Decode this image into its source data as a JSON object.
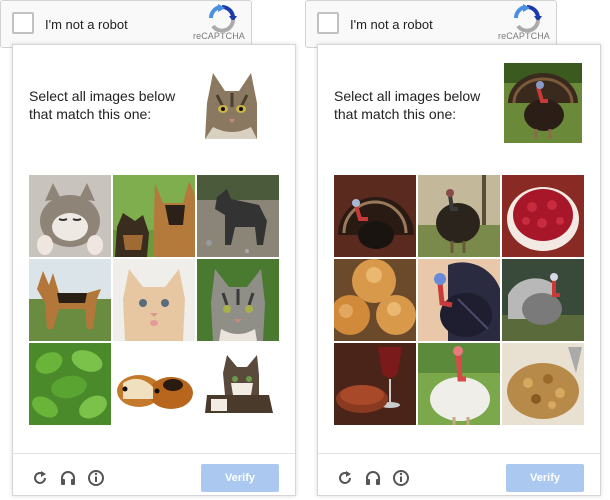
{
  "widgets": [
    {
      "checkbox_label": "I'm not a robot",
      "brand": "reCAPTCHA",
      "prompt": "Select all images below that match this one:",
      "sample_image": "cat-tabby",
      "grid_images": [
        "kitten-sleeping",
        "german-shepherd-puppies",
        "grey-dog",
        "german-shepherd-standing",
        "orange-kitten",
        "tabby-kitten",
        "green-leaves",
        "guinea-pigs",
        "kitten-lying"
      ],
      "verify_label": "Verify"
    },
    {
      "checkbox_label": "I'm not a robot",
      "brand": "reCAPTCHA",
      "prompt": "Select all images below that match this one:",
      "sample_image": "turkey-on-grass",
      "grid_images": [
        "turkey-fanned",
        "turkey-in-field",
        "cranberry-sauce",
        "bread-rolls",
        "turkey-blue-head",
        "grey-turkey",
        "wine-glass-pie",
        "white-turkey",
        "stuffing"
      ],
      "verify_label": "Verify"
    }
  ],
  "colors": {
    "verify_button": "#aac8f0",
    "logo_blue": "#1c3aa9",
    "logo_light_blue": "#4a90e2",
    "logo_grey": "#ababab"
  }
}
